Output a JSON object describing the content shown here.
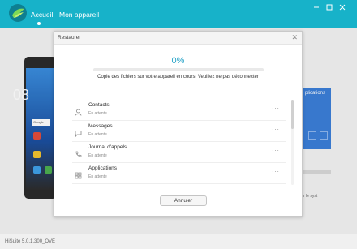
{
  "header": {
    "nav": [
      {
        "label": "Accueil",
        "active": true
      },
      {
        "label": "Mon appareil",
        "active": false
      }
    ],
    "window_controls": [
      "minimize-icon",
      "restore-icon",
      "close-icon"
    ]
  },
  "background": {
    "phone_time": "08",
    "phone_search": "Google",
    "right_card_text": "plications",
    "right_note": "r le syst"
  },
  "footer": {
    "version": "HiSuite 5.0.1.300_OVE"
  },
  "dialog": {
    "title": "Restaurer",
    "progress_text": "0%",
    "progress_value": 0,
    "message": "Copie des fichiers sur votre appareil en cours. Veuillez ne pas déconnecter",
    "items": [
      {
        "name": "Contacts",
        "status": "En attente",
        "icon": "person-icon"
      },
      {
        "name": "Messages",
        "status": "En attente",
        "icon": "message-icon"
      },
      {
        "name": "Journal d'appels",
        "status": "En attente",
        "icon": "phone-icon"
      },
      {
        "name": "Applications",
        "status": "En attente",
        "icon": "apps-grid-icon"
      }
    ],
    "cancel_label": "Annuler"
  },
  "colors": {
    "header": "#17b2c9",
    "accent": "#2ba5c9"
  }
}
